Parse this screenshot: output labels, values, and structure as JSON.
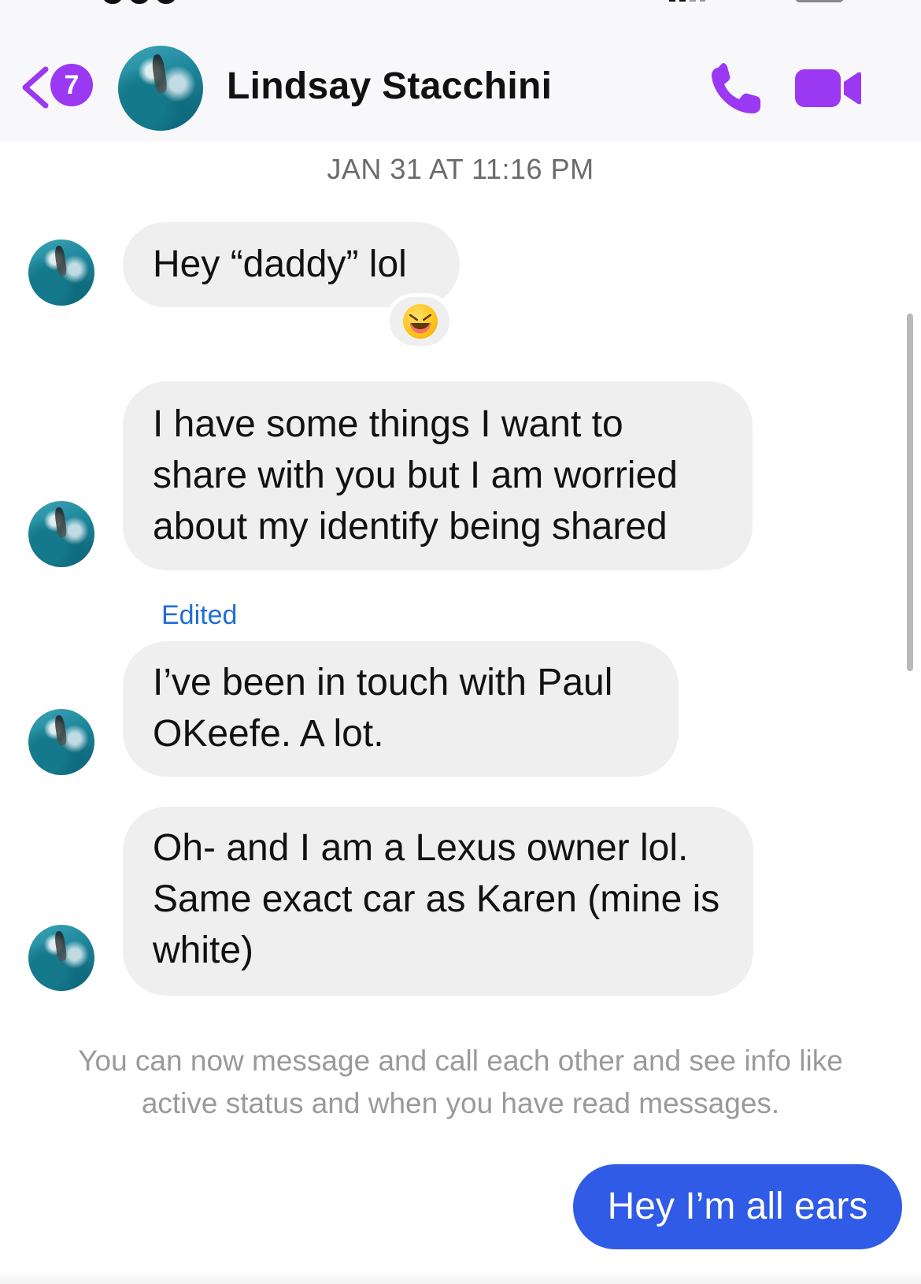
{
  "header": {
    "back_badge_count": "7",
    "contact_name": "Lindsay Stacchini",
    "accent_color": "#9b38f1"
  },
  "thread": {
    "timestamp": "JAN 31 AT 11:16 PM",
    "messages": [
      {
        "direction": "incoming",
        "text": "Hey “daddy” lol",
        "reaction": "laughing-squinting-face-emoji"
      },
      {
        "direction": "incoming",
        "text": "I have some things I want to share with you but I am worried about my identify being shared"
      },
      {
        "direction": "incoming",
        "label": "Edited",
        "text": "I’ve been in touch with Paul OKeefe. A lot."
      },
      {
        "direction": "incoming",
        "text": "Oh- and I am a Lexus owner lol. Same exact car as Karen (mine is white)"
      }
    ],
    "notice": "You can now message and call each other and see info like active status and when you have read messages.",
    "outgoing": [
      {
        "direction": "outgoing",
        "text": "Hey I’m all ears",
        "color": "#2f5be6"
      }
    ]
  },
  "icons": {
    "back": "chevron-left-icon",
    "call": "phone-icon",
    "video": "video-camera-icon"
  }
}
